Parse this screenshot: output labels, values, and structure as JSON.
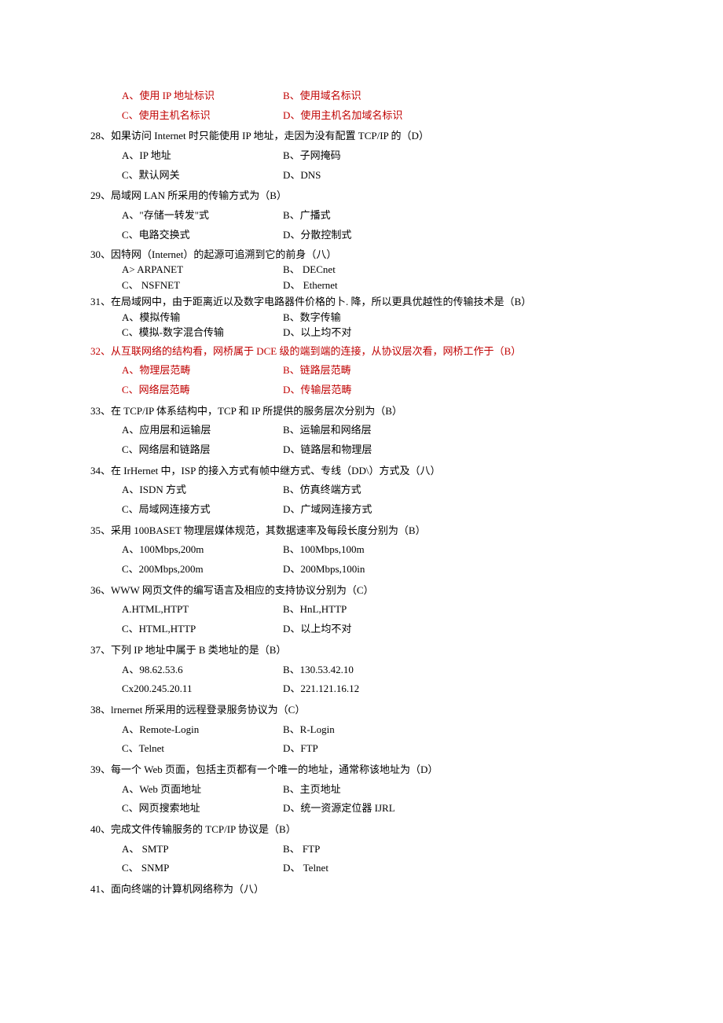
{
  "questions": [
    {
      "num": "",
      "text": "",
      "red": true,
      "opts": [
        [
          "A、使用 IP 地址标识",
          "B、使用域名标识"
        ],
        [
          "C、使用主机名标识",
          "D、使用主机名加域名标识"
        ]
      ]
    },
    {
      "num": "28、",
      "text": "如果访问 Internet 时只能使用 IP 地址，走因为没有配置 TCP/IP 的（D）",
      "opts": [
        [
          "A、IP 地址",
          "B、子网掩码"
        ],
        [
          "C、默认网关",
          "D、DNS"
        ]
      ]
    },
    {
      "num": "29、",
      "text": "局域网 LAN 所采用的传输方式为（B）",
      "opts": [
        [
          "A、\"存储一转发\"式",
          "B、广播式"
        ],
        [
          "C、电路交换式",
          "D、分散控制式"
        ]
      ]
    },
    {
      "num": "30、",
      "text": "因特网（Internet）的起源可追溯到它的前身（八）",
      "tight": true,
      "opts": [
        [
          "A> ARPANET",
          "B、 DECnet"
        ],
        [
          "C、 NSFNET",
          "D、 Ethernet"
        ]
      ]
    },
    {
      "num": "31、",
      "text": "在局域网中，由于距离近以及数字电路器件价格的卜. 降，所以更具优越性的传输技术是（B）",
      "tight": true,
      "hang": true,
      "opts": [
        [
          "A、模拟传输",
          "B、数字传输"
        ],
        [
          "C、模拟-数字混合传输",
          "D、以上均不对"
        ]
      ]
    },
    {
      "num": "32、",
      "text": "从互联网络的结构看，网桥属于 DCE 级的端到端的连接，从协议层次看，网桥工作于（B）",
      "red": true,
      "opts": [
        [
          "A、物理层范畴",
          "B、链路层范畴"
        ],
        [
          "C、网络层范畴",
          "D、传输层范畴"
        ]
      ]
    },
    {
      "num": "33、",
      "text": "在 TCP/IP 体系结构中，TCP 和 IP 所提供的服务层次分别为（B）",
      "opts": [
        [
          "A、应用层和运输层",
          "B、运输层和网络层"
        ],
        [
          "C、网络层和链路层",
          "D、链路层和物理层"
        ]
      ]
    },
    {
      "num": "34、",
      "text": "在 IrHernet 中，ISP 的接入方式有帧中继方式、专线（DD\\）方式及（八）",
      "opts": [
        [
          "A、ISDN 方式",
          "B、仿真终端方式"
        ],
        [
          "C、局域网连接方式",
          "D、广域网连接方式"
        ]
      ]
    },
    {
      "num": "35、",
      "text": "采用 100BASET 物理层媒体规范，其数据速率及每段长度分别为（B）",
      "opts": [
        [
          "A、100Mbps,200m",
          "B、100Mbps,100m"
        ],
        [
          "C、200Mbps,200m",
          "D、200Mbps,100in"
        ]
      ]
    },
    {
      "num": "36、",
      "text": "WWW 网页文件的编写语言及相应的支持协议分别为（C）",
      "opts": [
        [
          "A.HTML,HTPT",
          "B、HnL,HTTP"
        ],
        [
          "C、HTML,HTTP",
          "D、以上均不对"
        ]
      ]
    },
    {
      "num": "37、",
      "text": "下列 IP 地址中属于 B 类地址的是（B）",
      "opts": [
        [
          "A、98.62.53.6",
          "B、130.53.42.10"
        ],
        [
          "Cx200.245.20.11",
          "D、221.121.16.12"
        ]
      ]
    },
    {
      "num": "38、",
      "text": "lrnernet 所采用的远程登录服务协议为（C）",
      "opts": [
        [
          "A、Remote-Login",
          "B、R-Login"
        ],
        [
          "C、Telnet",
          "D、FTP"
        ]
      ]
    },
    {
      "num": "39、",
      "text": "每一个 Web 页面，包括主页都有一个唯一的地址，通常称该地址为（D）",
      "opts": [
        [
          "A、Web 页面地址",
          "B、主页地址"
        ],
        [
          "C、网页搜索地址",
          "D、统一资源定位器 IJRL"
        ]
      ]
    },
    {
      "num": "40、",
      "text": "完成文件传输服务的 TCP/IP 协议是（B）",
      "opts": [
        [
          "A、 SMTP",
          "B、 FTP"
        ],
        [
          "C、 SNMP",
          "D、 Telnet"
        ]
      ]
    },
    {
      "num": "41、",
      "text": "面向终端的计算机网络称为（八）",
      "opts": []
    }
  ]
}
